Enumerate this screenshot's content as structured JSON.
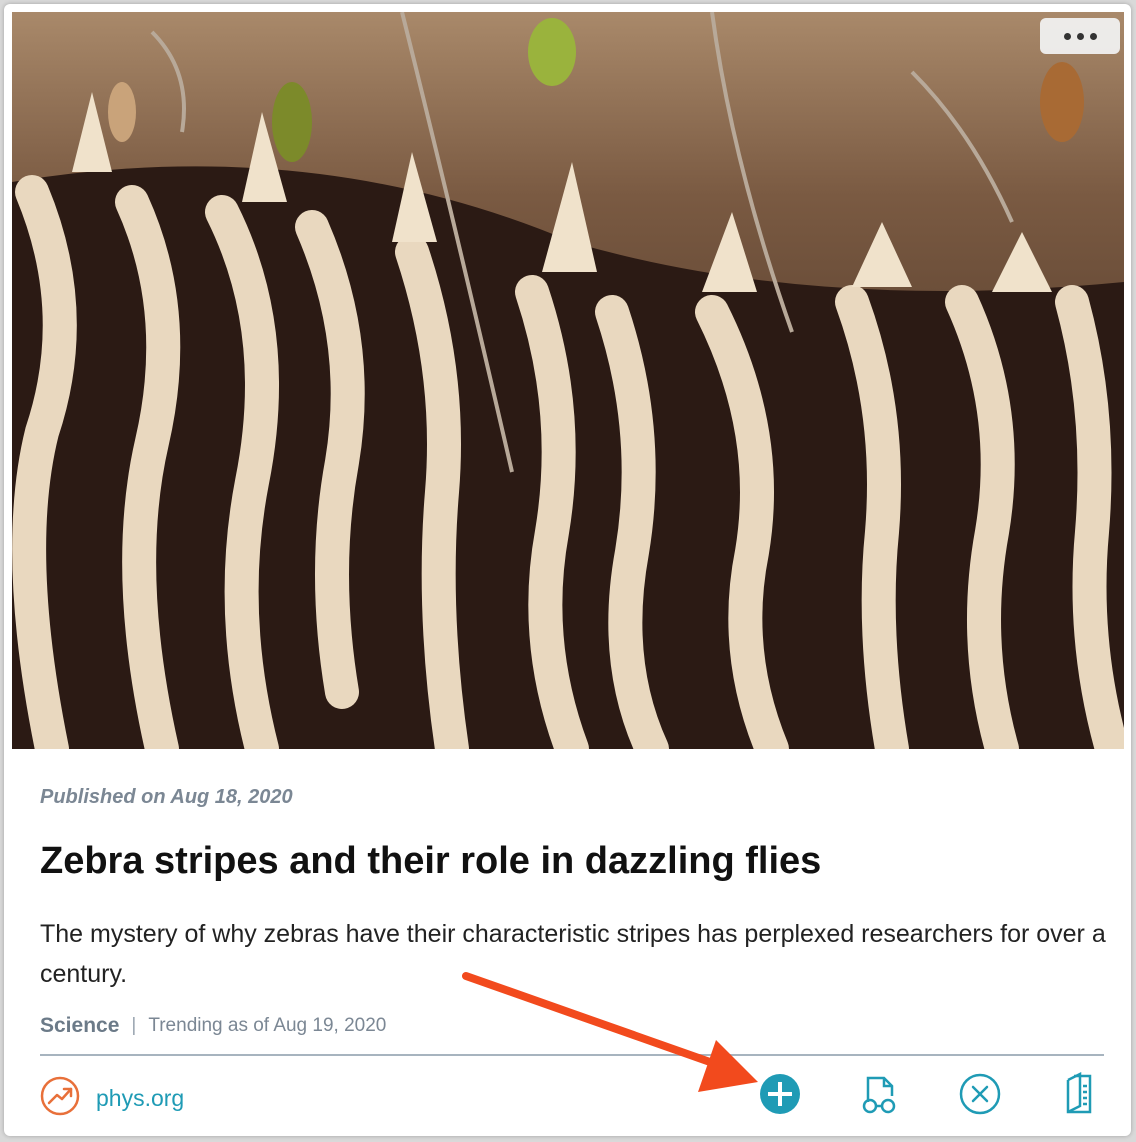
{
  "article": {
    "published": "Published on Aug 18, 2020",
    "title": "Zebra stripes and their role in dazzling flies",
    "summary": "The mystery of why zebras have their characteristic stripes has perplexed researchers for over a century.",
    "category": "Science",
    "separator": "|",
    "trending": "Trending as of Aug 19, 2020",
    "source": "phys.org"
  },
  "icons": {
    "source": "trending-up-icon",
    "more": "ellipsis-icon",
    "add": "plus-circle-icon",
    "read": "glasses-icon",
    "dismiss": "close-circle-icon",
    "open": "book-icon",
    "annotation": "red-arrow-annotation"
  },
  "colors": {
    "accent": "#1f9bb5",
    "source_icon": "#e8703a",
    "annotation_arrow": "#f24a1d",
    "meta_text": "#7b8794"
  }
}
